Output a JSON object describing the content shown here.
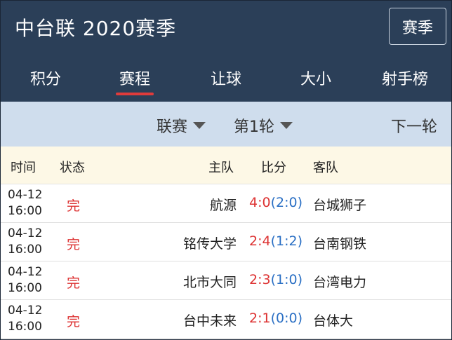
{
  "header": {
    "title": "中台联  2020赛季",
    "season_button": "赛季"
  },
  "tabs": [
    {
      "label": "积分",
      "active": false
    },
    {
      "label": "赛程",
      "active": true
    },
    {
      "label": "让球",
      "active": false
    },
    {
      "label": "大小",
      "active": false
    },
    {
      "label": "射手榜",
      "active": false
    }
  ],
  "filters": {
    "league": "联赛",
    "round": "第1轮",
    "next": "下一轮"
  },
  "table": {
    "columns": {
      "time": "时间",
      "status": "状态",
      "home": "主队",
      "score": "比分",
      "away": "客队"
    },
    "rows": [
      {
        "date": "04-12",
        "time": "16:00",
        "status": "完",
        "home": "航源",
        "ft": "4:0",
        "ht": "(2:0)",
        "away": "台城狮子"
      },
      {
        "date": "04-12",
        "time": "16:00",
        "status": "完",
        "home": "铭传大学",
        "ft": "2:4",
        "ht": "(1:2)",
        "away": "台南钢铁"
      },
      {
        "date": "04-12",
        "time": "16:00",
        "status": "完",
        "home": "北市大同",
        "ft": "2:3",
        "ht": "(1:0)",
        "away": "台湾电力"
      },
      {
        "date": "04-12",
        "time": "16:00",
        "status": "完",
        "home": "台中未来",
        "ft": "2:1",
        "ht": "(0:0)",
        "away": "台体大"
      }
    ]
  },
  "colors": {
    "header_bg": "#2b3f58",
    "filter_bg": "#cfdded",
    "table_header_bg": "#fdf8e6",
    "accent_red": "#e03b3b",
    "score_red": "#dd3333",
    "halftime_blue": "#2a6fc4"
  }
}
